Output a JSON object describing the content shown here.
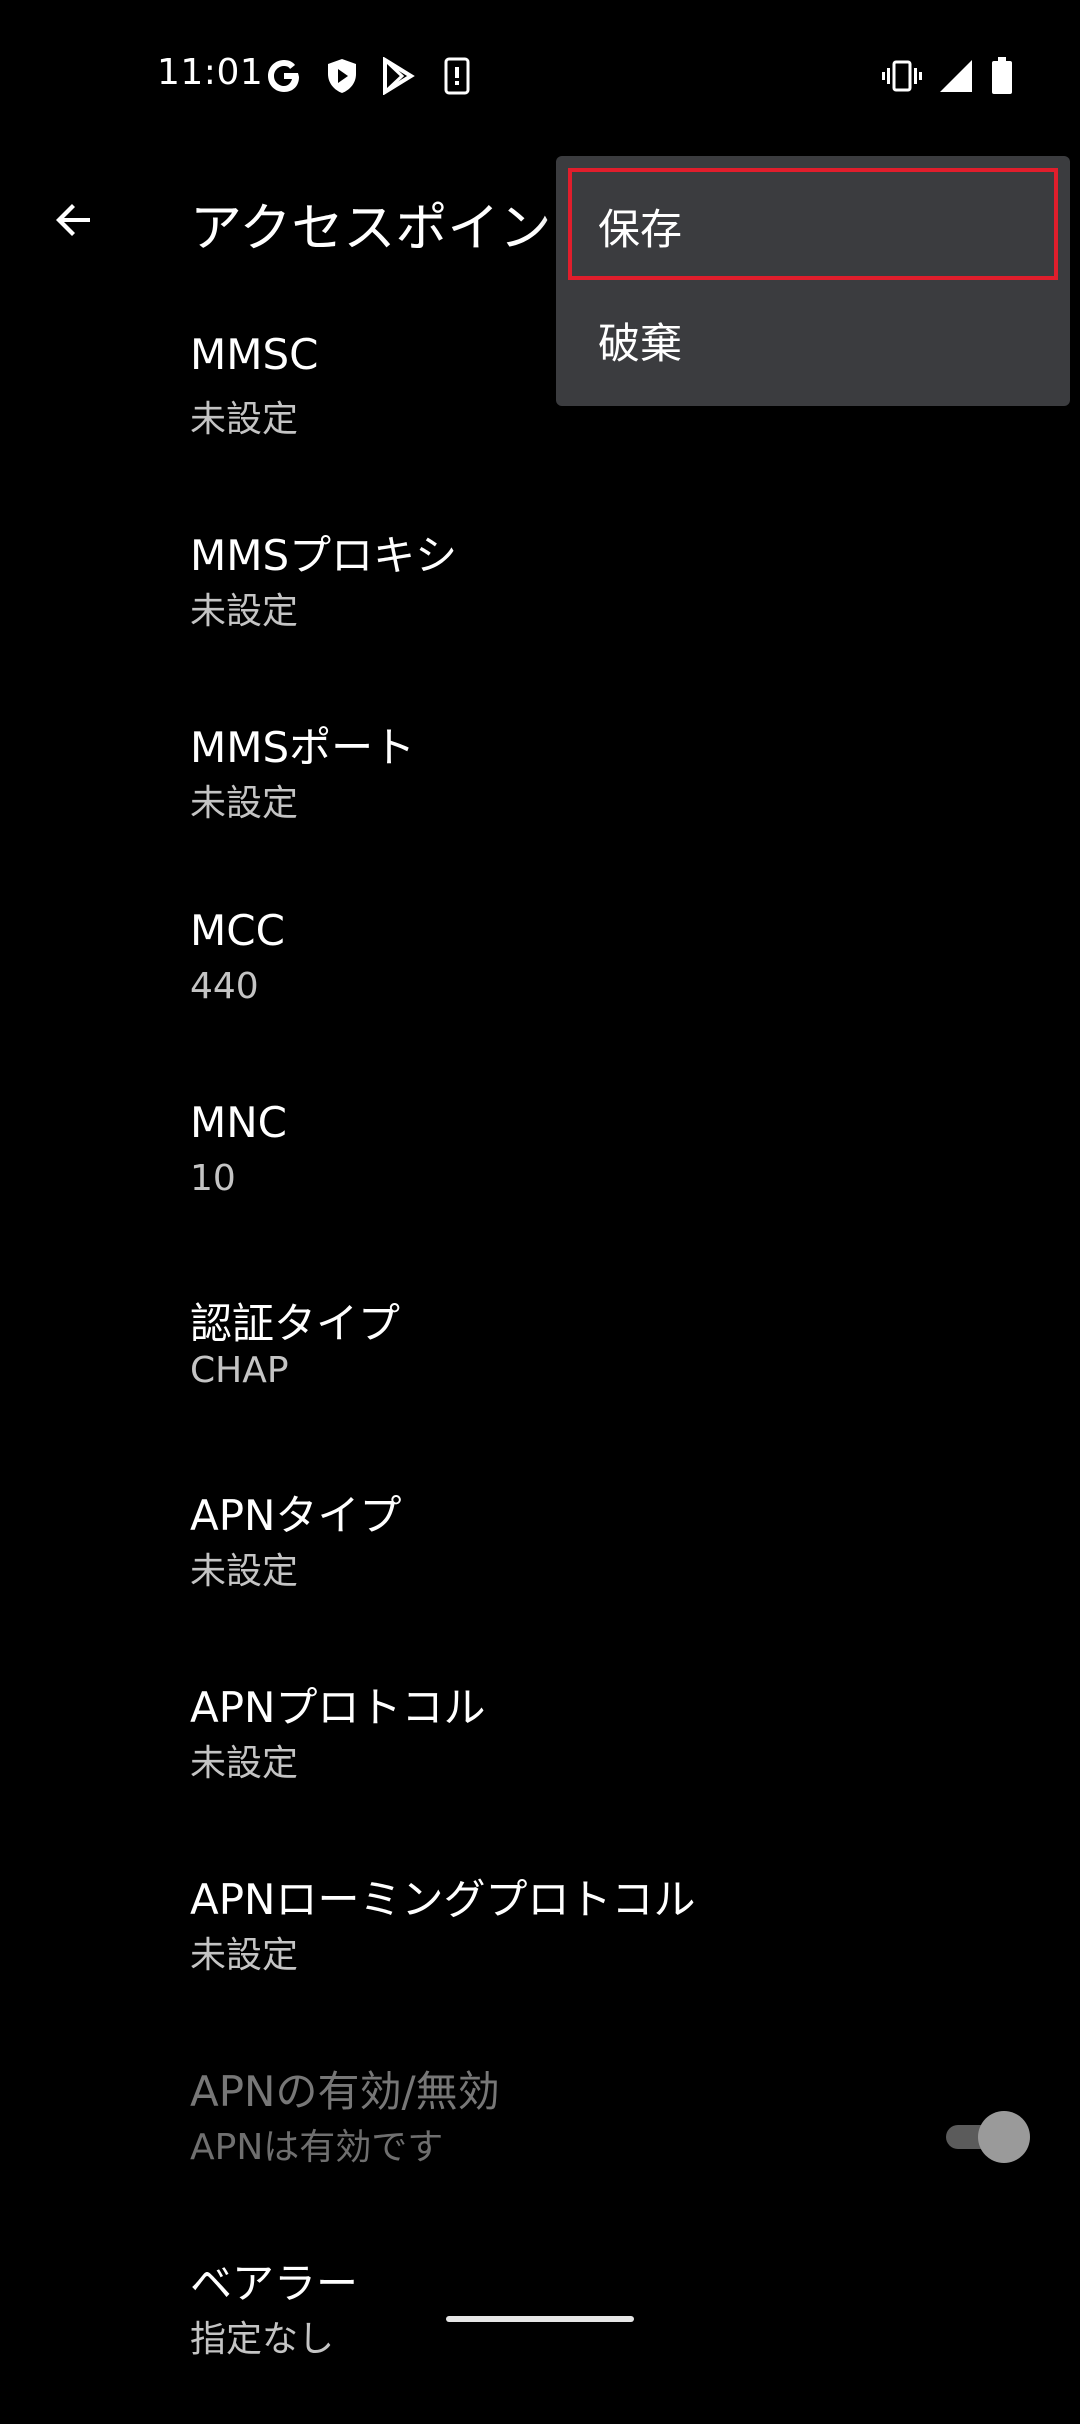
{
  "status_bar": {
    "time": "11:01",
    "icons": [
      "google-icon",
      "shield-play-icon",
      "play-store-icon",
      "device-icon",
      "vibrate-icon",
      "signal-icon",
      "battery-icon"
    ]
  },
  "app_bar": {
    "title": "アクセスポイン"
  },
  "menu": {
    "items": [
      {
        "label": "保存"
      },
      {
        "label": "破棄"
      }
    ]
  },
  "list": {
    "items": [
      {
        "title": "MMSC",
        "summary": "未設定"
      },
      {
        "title": "MMSプロキシ",
        "summary": "未設定"
      },
      {
        "title": "MMSポート",
        "summary": "未設定"
      },
      {
        "title": "MCC",
        "summary": "440"
      },
      {
        "title": "MNC",
        "summary": "10"
      },
      {
        "title": "認証タイプ",
        "summary": "CHAP"
      },
      {
        "title": "APNタイプ",
        "summary": "未設定"
      },
      {
        "title": "APNプロトコル",
        "summary": "未設定"
      },
      {
        "title": "APNローミングプロトコル",
        "summary": "未設定"
      },
      {
        "title": "APNの有効/無効",
        "summary": "APNは有効です",
        "toggle_on": true
      },
      {
        "title": "ベアラー",
        "summary": "指定なし"
      }
    ]
  },
  "colors": {
    "background": "#000000",
    "menu_background": "#3b3c3f",
    "highlight": "#e01e2c"
  }
}
